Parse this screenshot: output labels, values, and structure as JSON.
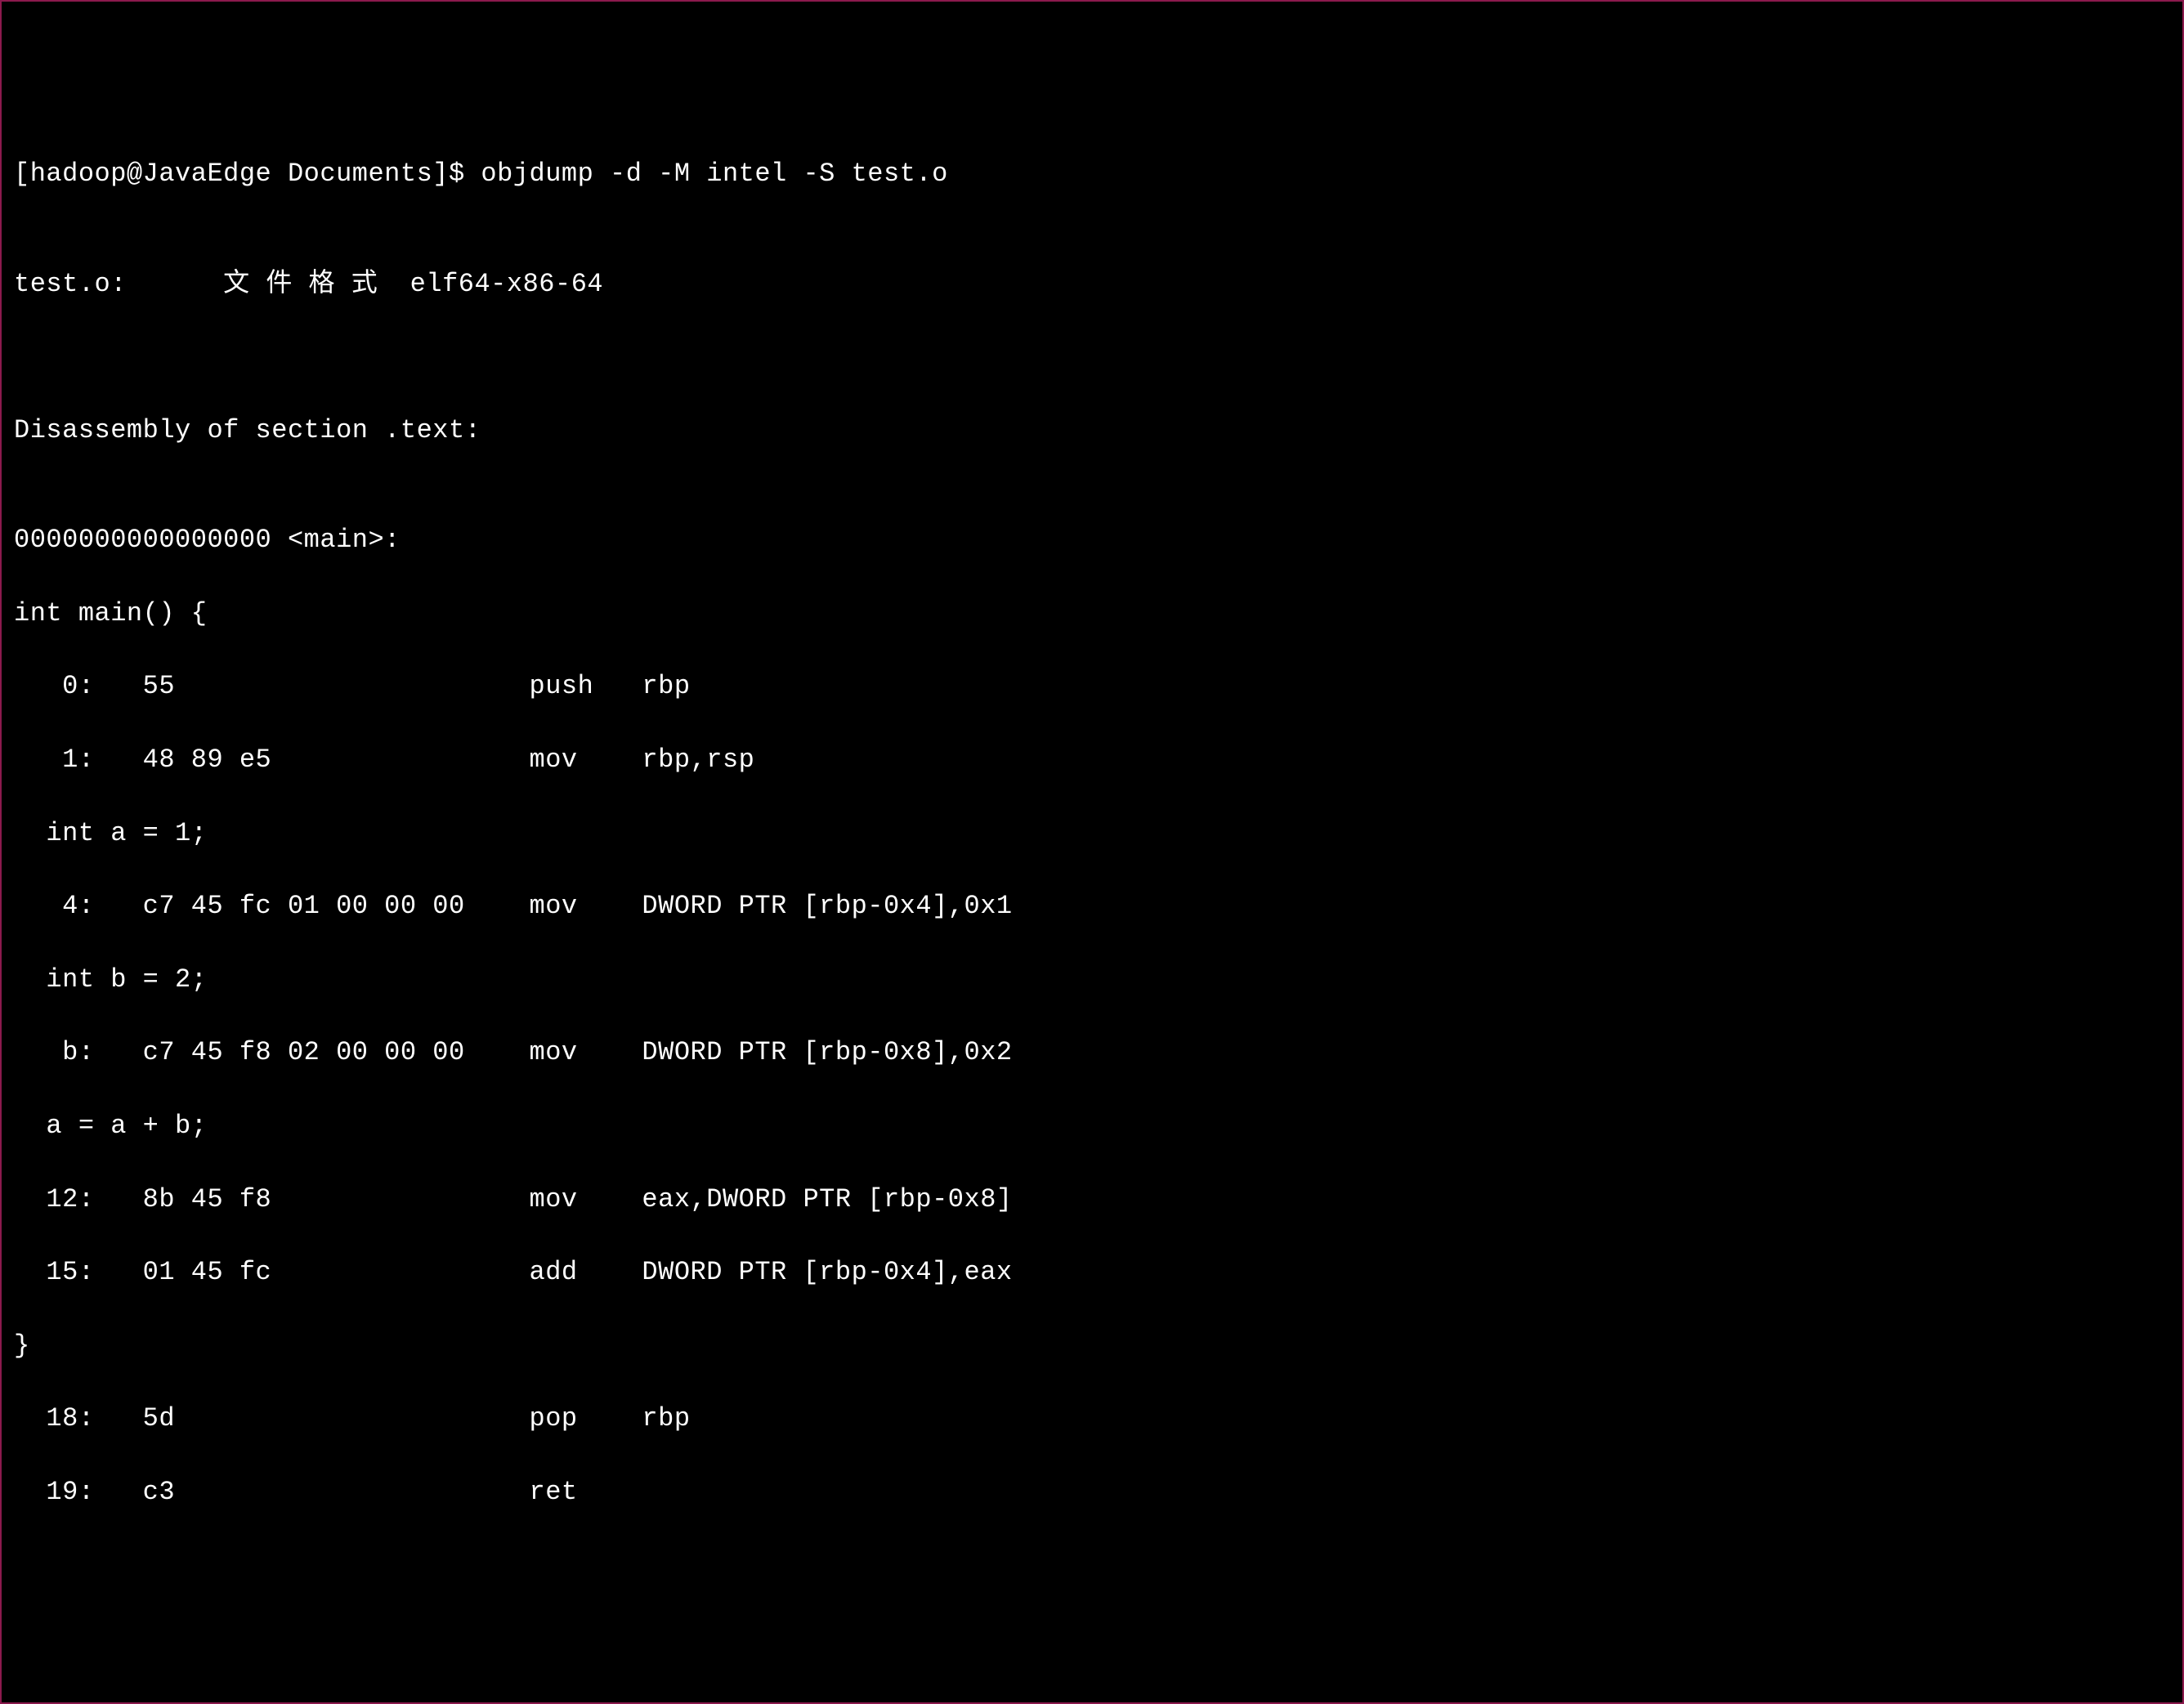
{
  "terminal": {
    "prompt": "[hadoop@JavaEdge Documents]$ objdump -d -M intel -S test.o",
    "blank1": "",
    "fileinfo": "test.o:      文 件 格 式  elf64-x86-64",
    "blank2": "",
    "blank3": "",
    "section_header": "Disassembly of section .text:",
    "blank4": "",
    "symbol": "0000000000000000 <main>:",
    "src_main": "int main() {",
    "asm_0": "   0:   55                      push   rbp",
    "asm_1": "   1:   48 89 e5                mov    rbp,rsp",
    "src_a": "  int a = 1;",
    "asm_4": "   4:   c7 45 fc 01 00 00 00    mov    DWORD PTR [rbp-0x4],0x1",
    "src_b": "  int b = 2;",
    "asm_b": "   b:   c7 45 f8 02 00 00 00    mov    DWORD PTR [rbp-0x8],0x2",
    "src_ab": "  a = a + b;",
    "asm_12": "  12:   8b 45 f8                mov    eax,DWORD PTR [rbp-0x8]",
    "asm_15": "  15:   01 45 fc                add    DWORD PTR [rbp-0x4],eax",
    "src_end": "}",
    "asm_18": "  18:   5d                      pop    rbp",
    "asm_19": "  19:   c3                      ret"
  }
}
